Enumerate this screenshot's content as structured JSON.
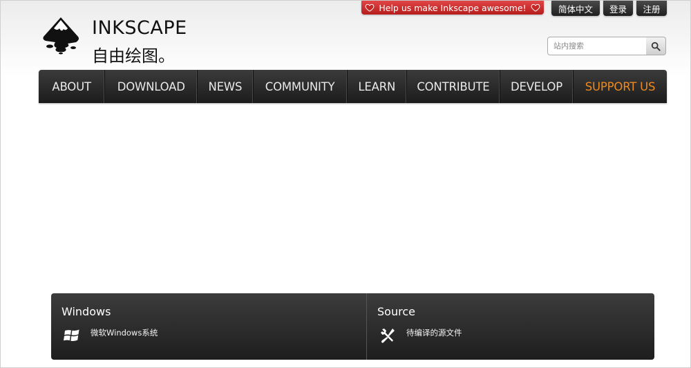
{
  "topbar": {
    "help_banner": "Help us make Inkscape awesome!",
    "language": "简体中文",
    "login": "登录",
    "register": "注册"
  },
  "logo": {
    "title": "INKSCAPE",
    "tagline": "自由绘图。"
  },
  "search": {
    "placeholder": "站内搜索"
  },
  "nav": {
    "items": [
      {
        "label": "ABOUT"
      },
      {
        "label": "DOWNLOAD"
      },
      {
        "label": "NEWS"
      },
      {
        "label": "COMMUNITY"
      },
      {
        "label": "LEARN"
      },
      {
        "label": "CONTRIBUTE"
      },
      {
        "label": "DEVELOP"
      },
      {
        "label": "SUPPORT US"
      }
    ]
  },
  "downloads": {
    "windows": {
      "title": "Windows",
      "link": "微软Windows系统"
    },
    "source": {
      "title": "Source",
      "link": "待编译的源文件"
    }
  },
  "colors": {
    "banner_red": "#c62828",
    "nav_dark": "#262626",
    "support_orange": "#f08a1e"
  }
}
